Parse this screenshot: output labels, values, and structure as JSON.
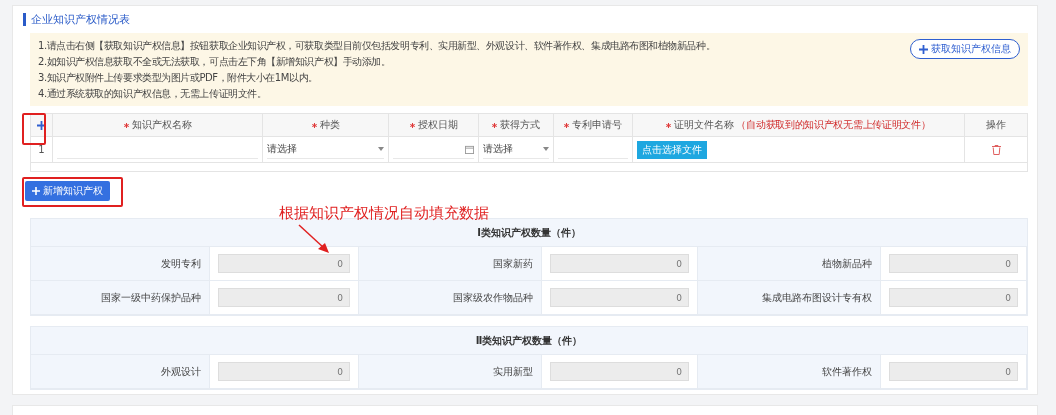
{
  "section": {
    "title": "企业知识产权情况表"
  },
  "notice": {
    "lines": [
      "1.请点击右侧【获取知识产权信息】按钮获取企业知识产权，可获取类型目前仅包括发明专利、实用新型、外观设计、软件著作权、集成电路布图和植物新品种。",
      "2.如知识产权信息获取不全或无法获取，可点击左下角【新增知识产权】手动添加。",
      "3.知识产权附件上传要求类型为图片或PDF，附件大小在1M以内。",
      "4.通过系统获取的知识产权信息，无需上传证明文件。"
    ],
    "fetch_button": "获取知识产权信息"
  },
  "table": {
    "columns": [
      {
        "label": "知识产权名称",
        "required": true
      },
      {
        "label": "种类",
        "required": true
      },
      {
        "label": "授权日期",
        "required": true
      },
      {
        "label": "获得方式",
        "required": true
      },
      {
        "label": "专利申请号",
        "required": true
      },
      {
        "label": "证明文件名称",
        "required": true,
        "note": "（自动获取到的知识产权无需上传证明文件）"
      },
      {
        "label": "操作",
        "required": false
      }
    ],
    "rows": [
      {
        "index": "1",
        "type": "请选择",
        "method": "请选择",
        "file_button": "点击选择文件"
      }
    ]
  },
  "add_button": "新增知识产权",
  "annotation": {
    "text": "根据知识产权情况自动填充数据"
  },
  "groups": [
    {
      "title": "Ⅰ类知识产权数量（件）",
      "items": [
        {
          "label": "发明专利",
          "value": "0"
        },
        {
          "label": "国家新药",
          "value": "0"
        },
        {
          "label": "植物新品种",
          "value": "0"
        },
        {
          "label": "国家一级中药保护品种",
          "value": "0"
        },
        {
          "label": "国家级农作物品种",
          "value": "0"
        },
        {
          "label": "集成电路布图设计专有权",
          "value": "0"
        }
      ]
    },
    {
      "title": "Ⅱ类知识产权数量（件）",
      "items": [
        {
          "label": "外观设计",
          "value": "0"
        },
        {
          "label": "实用新型",
          "value": "0"
        },
        {
          "label": "软件著作权",
          "value": "0"
        }
      ]
    }
  ]
}
